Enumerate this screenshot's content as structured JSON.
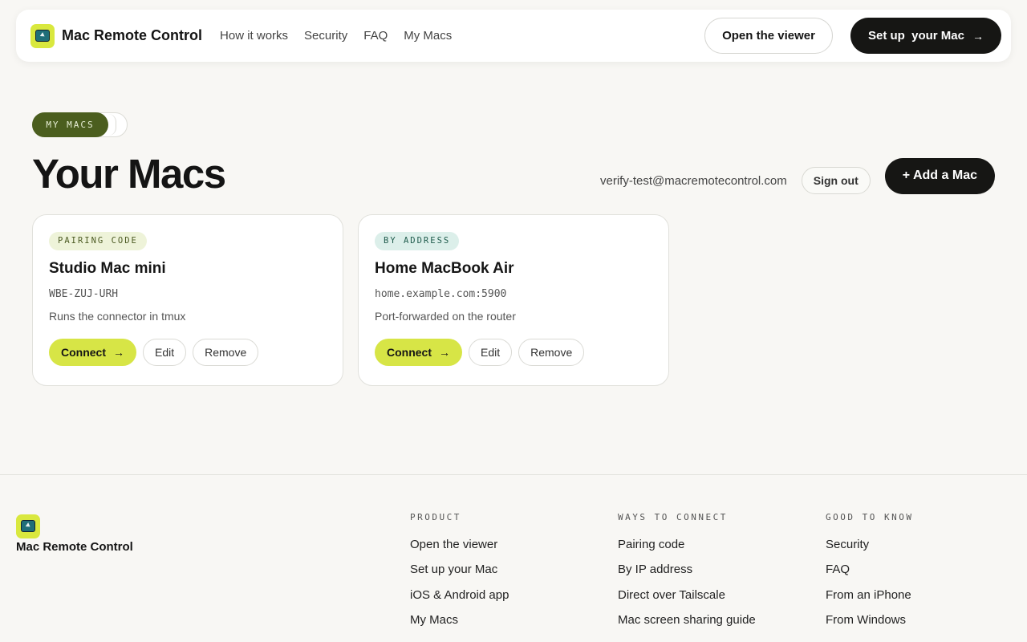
{
  "header": {
    "brand": "Mac Remote Control",
    "nav": [
      "How it works",
      "Security",
      "FAQ",
      "My Macs"
    ],
    "open_viewer": "Open the viewer",
    "setup": "Set up  your Mac",
    "setup_arrow": "→"
  },
  "page": {
    "toggle_label": "MY MACS",
    "title": "Your Macs",
    "email": "verify-test@macremotecontrol.com",
    "sign_out": "Sign out",
    "add_mac": "+ Add a Mac"
  },
  "cards": [
    {
      "tag": "PAIRING CODE",
      "name": "Studio Mac mini",
      "code": "WBE-ZUJ-URH",
      "note": "Runs the connector in tmux",
      "connect": "Connect",
      "arrow": "→",
      "edit": "Edit",
      "remove": "Remove"
    },
    {
      "tag": "BY ADDRESS",
      "name": "Home MacBook Air",
      "code": "home.example.com:5900",
      "note": "Port-forwarded on the router",
      "connect": "Connect",
      "arrow": "→",
      "edit": "Edit",
      "remove": "Remove"
    }
  ],
  "footer": {
    "brand": "Mac Remote Control",
    "product": {
      "heading": "PRODUCT",
      "links": [
        "Open the viewer",
        "Set up your Mac",
        "iOS & Android app",
        "My Macs"
      ]
    },
    "ways": {
      "heading": "WAYS TO CONNECT",
      "links": [
        "Pairing code",
        "By IP address",
        "Direct over Tailscale",
        "Mac screen sharing guide"
      ]
    },
    "good": {
      "heading": "GOOD TO KNOW",
      "links": [
        "Security",
        "FAQ",
        "From an iPhone",
        "From Windows"
      ]
    }
  },
  "colors": {
    "accent_lime": "#d7e546",
    "dark": "#161614",
    "olive": "#4b5e1e"
  }
}
